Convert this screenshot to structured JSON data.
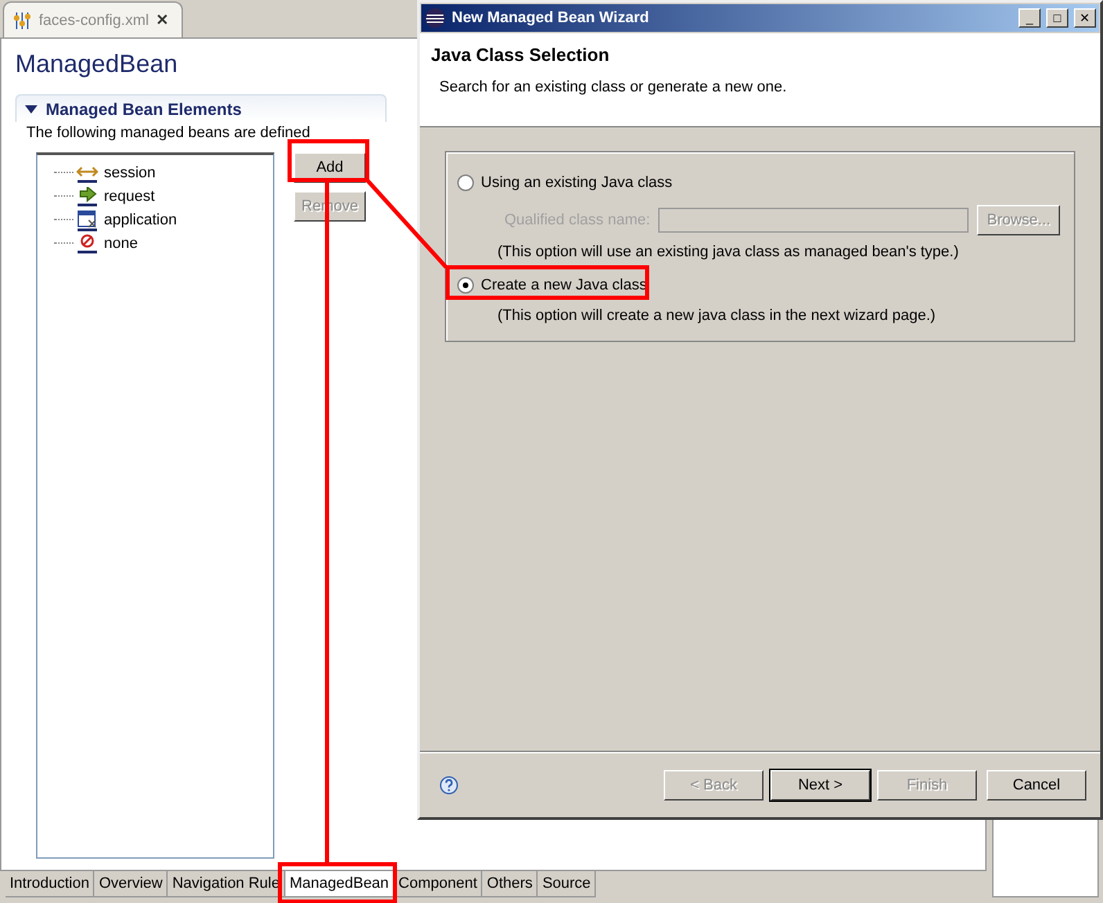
{
  "editor": {
    "tab": {
      "label": "faces-config.xml",
      "close": "✕"
    },
    "title": "ManagedBean",
    "section": {
      "title": "Managed Bean Elements",
      "expanded": true,
      "description": "The following managed beans are defined"
    },
    "tree": [
      {
        "label": "session",
        "kind": "session"
      },
      {
        "label": "request",
        "kind": "request"
      },
      {
        "label": "application",
        "kind": "application"
      },
      {
        "label": "none",
        "kind": "none"
      }
    ],
    "buttons": [
      {
        "label": "Add",
        "disabled": false
      },
      {
        "label": "Remove",
        "disabled": true
      }
    ],
    "pages": [
      {
        "label": "Introduction",
        "selected": false
      },
      {
        "label": "Overview",
        "selected": false
      },
      {
        "label": "Navigation Rule",
        "selected": false
      },
      {
        "label": "ManagedBean",
        "selected": true
      },
      {
        "label": "Component",
        "selected": false
      },
      {
        "label": "Others",
        "selected": false
      },
      {
        "label": "Source",
        "selected": false
      }
    ]
  },
  "dialog": {
    "title": "New Managed Bean Wizard",
    "window_buttons": [
      "_",
      "□",
      "✕"
    ],
    "header": {
      "title": "Java Class Selection",
      "description": "Search for an existing class or generate a new one."
    },
    "options": [
      {
        "label": "Using an existing Java class",
        "selected": false,
        "field": {
          "label": "Qualified class name:",
          "disabled": true
        },
        "browse": {
          "label": "Browse...",
          "disabled": true
        },
        "note": "(This option will use an existing java class as managed bean's type.)"
      },
      {
        "label": "Create a new Java class",
        "selected": true,
        "note": "(This option will create a new java class in the next wizard page.)"
      }
    ],
    "buttons": [
      {
        "label": "< Back",
        "disabled": true,
        "default": false
      },
      {
        "label": "Next >",
        "disabled": false,
        "default": true
      },
      {
        "label": "Finish",
        "disabled": true,
        "default": false
      },
      {
        "label": "Cancel",
        "disabled": false,
        "default": false
      }
    ]
  }
}
